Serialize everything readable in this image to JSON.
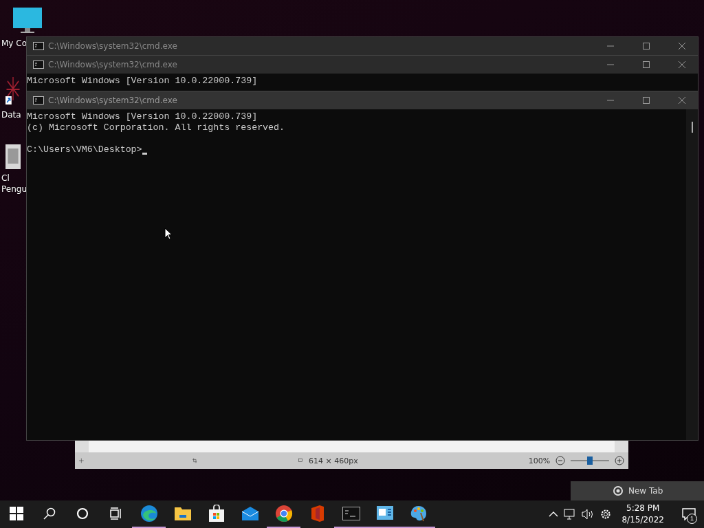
{
  "desktop_icons": [
    {
      "kind": "monitor",
      "lines": [
        "My Co"
      ]
    },
    {
      "kind": "shortcut",
      "lines": [
        "Data"
      ]
    },
    {
      "kind": "file",
      "lines": [
        "Cl",
        "Pengu"
      ]
    }
  ],
  "image_viewer": {
    "dimensions": "614 × 460px",
    "zoom": "100%",
    "level": 0.5
  },
  "windows": [
    {
      "title": "C:\\Windows\\system32\\cmd.exe",
      "active": false
    },
    {
      "title": "C:\\Windows\\system32\\cmd.exe",
      "active": false,
      "lines": [
        "Microsoft Windows [Version 10.0.22000.739]"
      ]
    },
    {
      "title": "C:\\Windows\\system32\\cmd.exe",
      "active": true,
      "lines": [
        "Microsoft Windows [Version 10.0.22000.739]",
        "(c) Microsoft Corporation. All rights reserved."
      ],
      "prompt": "C:\\Users\\VM6\\Desktop>"
    }
  ],
  "notification_preview": {
    "title": "New Tab"
  },
  "taskbar": {
    "apps": [
      {
        "kind": "edge",
        "running": true
      },
      {
        "kind": "folder",
        "running": false
      },
      {
        "kind": "store",
        "running": false
      },
      {
        "kind": "mail",
        "running": false
      },
      {
        "kind": "chrome",
        "running": true
      },
      {
        "kind": "office",
        "running": false
      },
      {
        "kind": "terminal",
        "running": true
      },
      {
        "kind": "panel",
        "running": true
      },
      {
        "kind": "paint",
        "running": true
      }
    ],
    "time": "5:28 PM",
    "date": "8/15/2022",
    "notifications": "1"
  }
}
